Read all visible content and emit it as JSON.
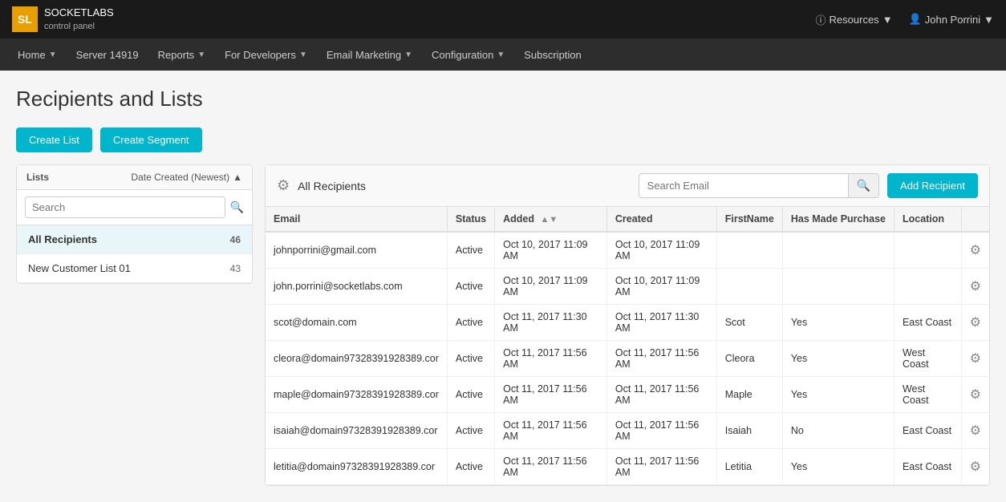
{
  "topbar": {
    "logo_text": "SOCKETLABS",
    "logo_sub": "control panel",
    "resources_label": "Resources",
    "user_label": "John Porrini"
  },
  "navbar": {
    "items": [
      {
        "label": "Home",
        "has_arrow": true
      },
      {
        "label": "Server 14919",
        "has_arrow": false
      },
      {
        "label": "Reports",
        "has_arrow": true
      },
      {
        "label": "For Developers",
        "has_arrow": true
      },
      {
        "label": "Email Marketing",
        "has_arrow": true
      },
      {
        "label": "Configuration",
        "has_arrow": true
      },
      {
        "label": "Subscription",
        "has_arrow": false
      }
    ]
  },
  "page": {
    "title": "Recipients and Lists",
    "create_list_btn": "Create List",
    "create_segment_btn": "Create Segment",
    "add_recipient_btn": "Add Recipient"
  },
  "sidebar": {
    "header_lists": "Lists",
    "header_sort": "Date Created (Newest)",
    "search_placeholder": "Search",
    "items": [
      {
        "name": "All Recipients",
        "count": "46",
        "active": true
      },
      {
        "name": "New Customer List 01",
        "count": "43",
        "active": false
      }
    ]
  },
  "recipients": {
    "title": "All Recipients",
    "search_placeholder": "Search Email",
    "columns": [
      "Email",
      "Status",
      "Added",
      "Created",
      "FirstName",
      "Has Made Purchase",
      "Location",
      ""
    ],
    "rows": [
      {
        "email": "johnporrini@gmail.com",
        "status": "Active",
        "added": "Oct 10, 2017 11:09 AM",
        "created": "Oct 10, 2017 11:09 AM",
        "firstname": "",
        "has_made_purchase": "",
        "location": ""
      },
      {
        "email": "john.porrini@socketlabs.com",
        "status": "Active",
        "added": "Oct 10, 2017 11:09 AM",
        "created": "Oct 10, 2017 11:09 AM",
        "firstname": "",
        "has_made_purchase": "",
        "location": ""
      },
      {
        "email": "scot@domain.com",
        "status": "Active",
        "added": "Oct 11, 2017 11:30 AM",
        "created": "Oct 11, 2017 11:30 AM",
        "firstname": "Scot",
        "has_made_purchase": "Yes",
        "location": "East Coast"
      },
      {
        "email": "cleora@domain97328391928389.cor",
        "status": "Active",
        "added": "Oct 11, 2017 11:56 AM",
        "created": "Oct 11, 2017 11:56 AM",
        "firstname": "Cleora",
        "has_made_purchase": "Yes",
        "location": "West Coast"
      },
      {
        "email": "maple@domain97328391928389.cor",
        "status": "Active",
        "added": "Oct 11, 2017 11:56 AM",
        "created": "Oct 11, 2017 11:56 AM",
        "firstname": "Maple",
        "has_made_purchase": "Yes",
        "location": "West Coast"
      },
      {
        "email": "isaiah@domain97328391928389.cor",
        "status": "Active",
        "added": "Oct 11, 2017 11:56 AM",
        "created": "Oct 11, 2017 11:56 AM",
        "firstname": "Isaiah",
        "has_made_purchase": "No",
        "location": "East Coast"
      },
      {
        "email": "letitia@domain97328391928389.cor",
        "status": "Active",
        "added": "Oct 11, 2017 11:56 AM",
        "created": "Oct 11, 2017 11:56 AM",
        "firstname": "Letitia",
        "has_made_purchase": "Yes",
        "location": "East Coast"
      }
    ]
  }
}
